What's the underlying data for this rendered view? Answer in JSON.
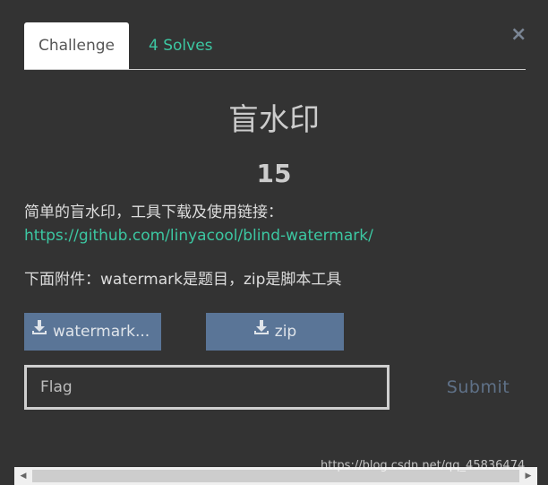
{
  "tabs": {
    "challenge_label": "Challenge",
    "solves_label": "4 Solves"
  },
  "close_symbol": "×",
  "challenge": {
    "title": "盲水印",
    "points": "15",
    "description_line1": "简单的盲水印，工具下载及使用链接：",
    "link_text": "https://github.com/linyacool/blind-watermark/",
    "description_line2": "下面附件：watermark是题目，zip是脚本工具"
  },
  "files": [
    {
      "label": "watermark..."
    },
    {
      "label": "zip"
    }
  ],
  "flag_input": {
    "placeholder": "Flag",
    "value": ""
  },
  "submit_label": "Submit",
  "watermark_text": "https://blog.csdn.net/qq_45836474",
  "colors": {
    "background": "#333333",
    "accent_green": "#3cc7a2",
    "file_button": "#5a7597",
    "submit_text": "#5f7188"
  },
  "icons": {
    "download": "download-icon",
    "close": "close-icon"
  }
}
